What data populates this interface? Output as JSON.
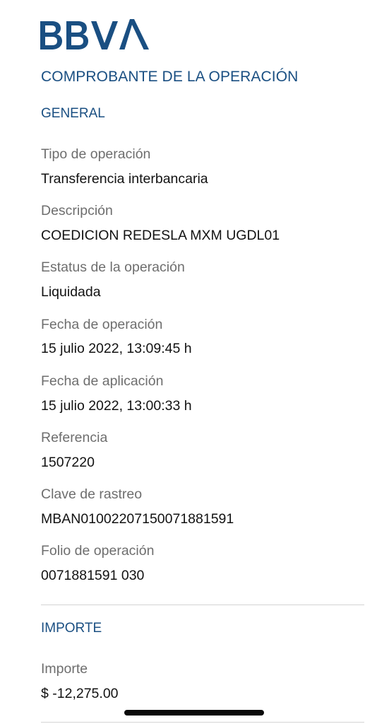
{
  "brand": {
    "logo_text": "BBVA",
    "color": "#1a4f82"
  },
  "title": "COMPROBANTE DE LA OPERACIÓN",
  "general": {
    "heading": "GENERAL",
    "fields": [
      {
        "label": "Tipo de operación",
        "value": "Transferencia interbancaria"
      },
      {
        "label": "Descripción",
        "value": "COEDICION REDESLA MXM UGDL01"
      },
      {
        "label": "Estatus de la operación",
        "value": "Liquidada"
      },
      {
        "label": "Fecha de operación",
        "value": "15 julio 2022, 13:09:45 h"
      },
      {
        "label": "Fecha de aplicación",
        "value": "15 julio 2022, 13:00:33 h"
      },
      {
        "label": "Referencia",
        "value": "1507220"
      },
      {
        "label": "Clave de rastreo",
        "value": "MBAN01002207150071881591"
      },
      {
        "label": "Folio de operación",
        "value": "0071881591 030"
      }
    ]
  },
  "importe": {
    "heading": "IMPORTE",
    "fields": [
      {
        "label": "Importe",
        "value": "$ -12,275.00"
      }
    ]
  },
  "colors": {
    "accent": "#1a4f82",
    "label": "#6e6e6e",
    "value": "#121212",
    "divider": "#d4d4d4"
  }
}
